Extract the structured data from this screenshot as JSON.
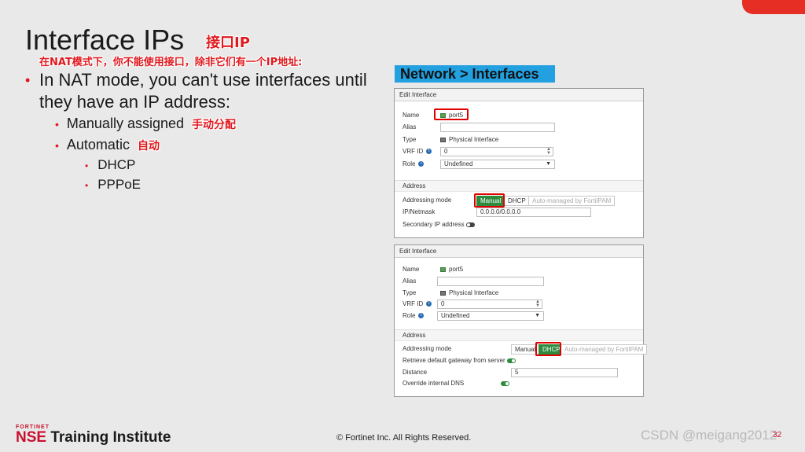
{
  "slide": {
    "title": "Interface IPs",
    "title_cn": "接口IP",
    "subtitle_cn": "在NAT模式下，你不能使用接口，除非它们有一个IP地址:",
    "nav_label": "Network > Interfaces",
    "page_number": "32"
  },
  "bullets": {
    "main": "In NAT mode, you can't use interfaces until they have an IP address:",
    "manual": "Manually assigned",
    "manual_cn": "手动分配",
    "auto": "Automatic",
    "auto_cn": "自动",
    "dhcp": "DHCP",
    "pppoe": "PPPoE"
  },
  "panel1": {
    "header": "Edit Interface",
    "name_label": "Name",
    "name_value": "port5",
    "alias_label": "Alias",
    "type_label": "Type",
    "type_value": "Physical Interface",
    "vrf_label": "VRF ID",
    "vrf_value": "0",
    "role_label": "Role",
    "role_value": "Undefined",
    "section_address": "Address",
    "addr_mode_label": "Addressing mode",
    "modes": [
      "Manual",
      "DHCP",
      "Auto-managed by FortiIPAM"
    ],
    "ipnet_label": "IP/Netmask",
    "ipnet_value": "0.0.0.0/0.0.0.0",
    "secondary_label": "Secondary IP address"
  },
  "panel2": {
    "header": "Edit Interface",
    "name_label": "Name",
    "name_value": "port5",
    "alias_label": "Alias",
    "type_label": "Type",
    "type_value": "Physical Interface",
    "vrf_label": "VRF ID",
    "vrf_value": "0",
    "role_label": "Role",
    "role_value": "Undefined",
    "section_address": "Address",
    "addr_mode_label": "Addressing mode",
    "modes": [
      "Manual",
      "DHCP",
      "Auto-managed by FortiIPAM"
    ],
    "gw_label": "Retrieve default gateway from server",
    "distance_label": "Distance",
    "distance_value": "5",
    "dns_label": "Override internal DNS"
  },
  "footer": {
    "brand_top": "FORTINET",
    "brand_nse": "NSE",
    "brand_rest": " Training Institute",
    "copyright": "© Fortinet Inc. All Rights Reserved.",
    "watermark": "CSDN @meigang2012"
  },
  "colors": {
    "accent_red": "#e0191e",
    "nav_blue": "#22a0e0",
    "toggle_green": "#2e8b3e"
  }
}
